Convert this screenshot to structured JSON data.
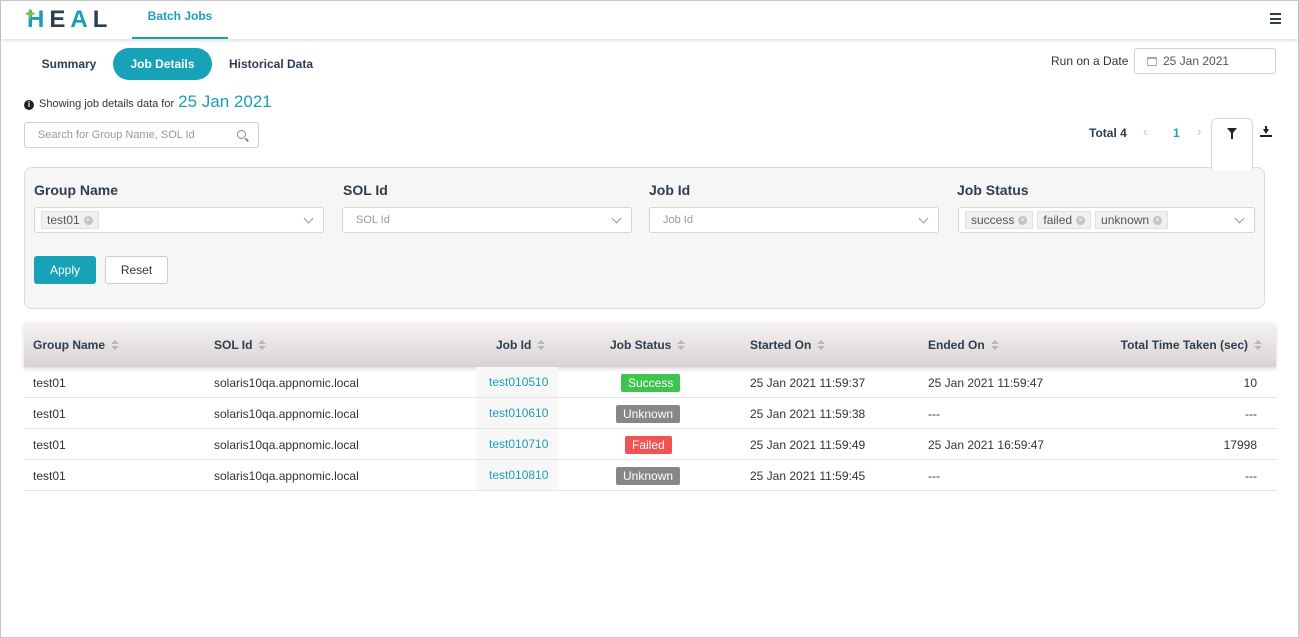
{
  "app": {
    "logo_text": "HEAL",
    "nav_tab": "Batch Jobs"
  },
  "tabs": [
    "Summary",
    "Job Details",
    "Historical Data"
  ],
  "run_on_date": {
    "label": "Run on a Date",
    "value": "25 Jan 2021"
  },
  "info": {
    "prefix": "Showing job details data for",
    "date": "25 Jan 2021"
  },
  "search": {
    "placeholder": "Search for Group Name, SOL Id"
  },
  "pagination": {
    "total": "Total 4",
    "prev": "‹",
    "page": "1",
    "next": "›"
  },
  "filters": {
    "group_name": {
      "label": "Group Name",
      "chips": [
        "test01"
      ]
    },
    "sol_id": {
      "label": "SOL Id",
      "placeholder": "SOL Id"
    },
    "job_id": {
      "label": "Job Id",
      "placeholder": "Job Id"
    },
    "job_status": {
      "label": "Job Status",
      "chips": [
        "success",
        "failed",
        "unknown"
      ]
    },
    "apply_label": "Apply",
    "reset_label": "Reset"
  },
  "table": {
    "headers": [
      "Group Name",
      "SOL Id",
      "Job Id",
      "Job Status",
      "Started On",
      "Ended On",
      "Total Time Taken (sec)"
    ],
    "rows": [
      {
        "group": "test01",
        "sol": "solaris10qa.appnomic.local",
        "job": "test010510",
        "status": "Success",
        "status_color": "#3ec44e",
        "started": "25 Jan 2021 11:59:37",
        "ended": "25 Jan 2021 11:59:47",
        "total": "10"
      },
      {
        "group": "test01",
        "sol": "solaris10qa.appnomic.local",
        "job": "test010610",
        "status": "Unknown",
        "status_color": "#878787",
        "started": "25 Jan 2021 11:59:38",
        "ended": "---",
        "total": "---"
      },
      {
        "group": "test01",
        "sol": "solaris10qa.appnomic.local",
        "job": "test010710",
        "status": "Failed",
        "status_color": "#ef5353",
        "started": "25 Jan 2021 11:59:49",
        "ended": "25 Jan 2021 16:59:47",
        "total": "17998"
      },
      {
        "group": "test01",
        "sol": "solaris10qa.appnomic.local",
        "job": "test010810",
        "status": "Unknown",
        "status_color": "#878787",
        "started": "25 Jan 2021 11:59:45",
        "ended": "---",
        "total": "---"
      }
    ]
  },
  "colors": {
    "accent": "#17a2b8",
    "brand_green": "#7cc242",
    "dark": "#2c3e50"
  }
}
